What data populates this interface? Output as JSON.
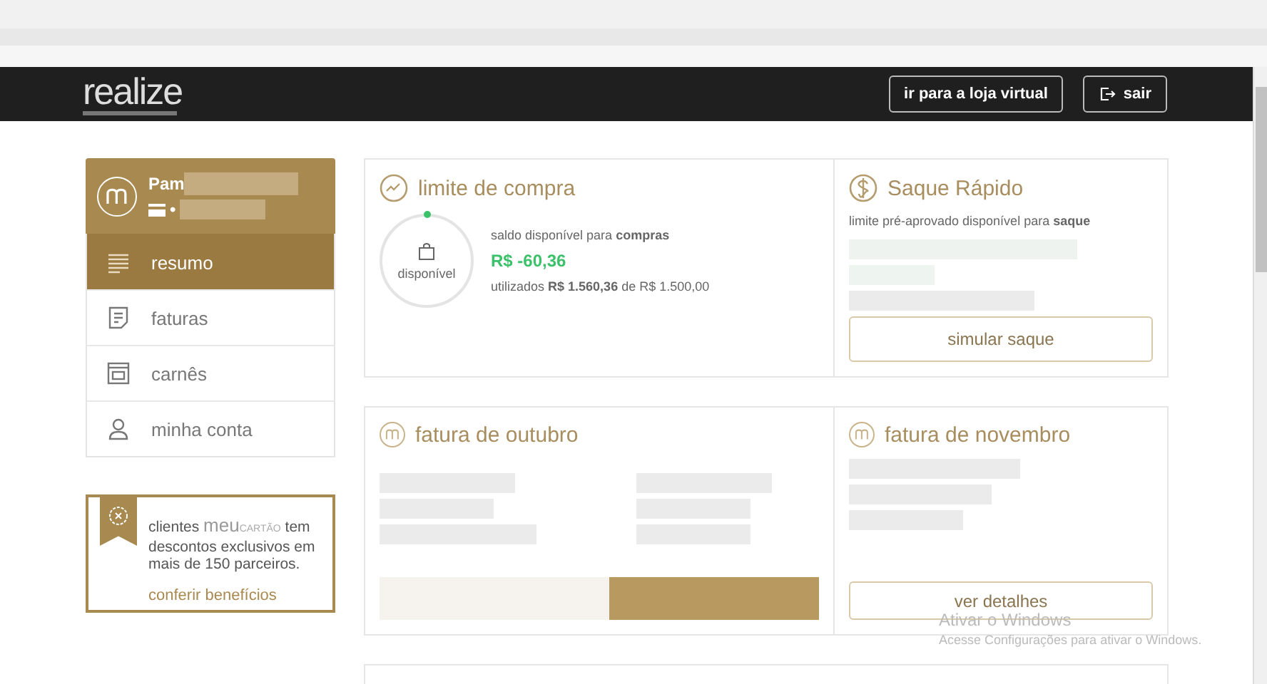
{
  "header": {
    "logo": "realize",
    "buttons": [
      {
        "label": "ir para a loja virtual",
        "kind": "store"
      },
      {
        "label": "sair",
        "kind": "logout"
      }
    ]
  },
  "profile": {
    "name": "Pam",
    "card_mark": "•"
  },
  "menu": [
    {
      "label": "resumo",
      "kind": "list",
      "selected": true
    },
    {
      "label": "faturas",
      "kind": "invoice",
      "selected": false
    },
    {
      "label": "carnês",
      "kind": "booklet",
      "selected": false
    },
    {
      "label": "minha conta",
      "kind": "user",
      "selected": false
    }
  ],
  "promo": {
    "before": "clientes",
    "brand_main": "meu",
    "brand_sub": "CARTÃO",
    "after": "tem descontos exclusivos em mais de 150 parceiros.",
    "link": "conferir benefícios"
  },
  "limit_card": {
    "title": "limite de compra",
    "ring_label": "disponível",
    "caption": "saldo disponível para **compras**",
    "amount": "R$ -60,36",
    "usage": "utilizados **R$ 1.560,36** de R$ 1.500,00"
  },
  "withdraw_card": {
    "title": "Saque Rápido",
    "caption": "limite pré-aprovado disponível para **saque**",
    "button": "simular saque"
  },
  "october_card": {
    "title": "fatura de outubro"
  },
  "november_card": {
    "title": "fatura de novembro",
    "button": "ver detalhes"
  },
  "windows_notice": {
    "title": "Ativar o Windows",
    "text": "Acesse Configurações para ativar o Windows."
  }
}
